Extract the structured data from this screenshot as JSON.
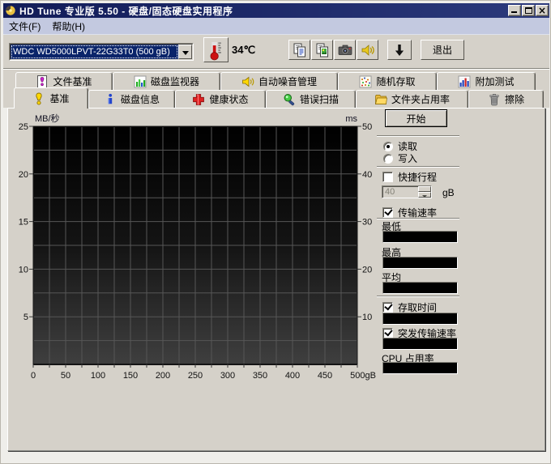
{
  "window": {
    "title": "HD Tune 专业版 5.50 - 硬盘/固态硬盘实用程序"
  },
  "menu": {
    "items": [
      "文件(F)",
      "帮助(H)"
    ]
  },
  "toolbar": {
    "drive_selected": "WDC WD5000LPVT-22G33T0 (500 gB)",
    "temperature": "34℃",
    "exit_label": "退出"
  },
  "tabs": {
    "row1": [
      {
        "label": "文件基准",
        "icon": "file-benchmark"
      },
      {
        "label": "磁盘监视器",
        "icon": "disk-monitor"
      },
      {
        "label": "自动噪音管理",
        "icon": "aam"
      },
      {
        "label": "随机存取",
        "icon": "random-access"
      },
      {
        "label": "附加测试",
        "icon": "extra-tests"
      }
    ],
    "row2": [
      {
        "label": "基准",
        "icon": "benchmark",
        "active": true
      },
      {
        "label": "磁盘信息",
        "icon": "disk-info"
      },
      {
        "label": "健康状态",
        "icon": "health"
      },
      {
        "label": "错误扫描",
        "icon": "error-scan"
      },
      {
        "label": "文件夹占用率",
        "icon": "folder-usage"
      },
      {
        "label": "擦除",
        "icon": "erase"
      }
    ]
  },
  "chart_data": {
    "type": "line",
    "series": [],
    "note": "empty benchmark grid, no measurement data plotted",
    "y_left": {
      "label": "MB/秒",
      "ticks": [
        "25",
        "20",
        "15",
        "10",
        "5"
      ],
      "range": [
        0,
        25
      ]
    },
    "y_right": {
      "label": "ms",
      "ticks": [
        "50",
        "40",
        "30",
        "20",
        "10"
      ],
      "range": [
        0,
        50
      ]
    },
    "x": {
      "ticks": [
        "0",
        "50",
        "100",
        "150",
        "200",
        "250",
        "300",
        "350",
        "400",
        "450",
        "500gB"
      ],
      "range": [
        0,
        500
      ]
    },
    "grid": true
  },
  "controls": {
    "start_label": "开始",
    "read_label": "读取",
    "write_label": "写入",
    "read_selected": true,
    "short_stroke_label": "快捷行程",
    "short_stroke_checked": false,
    "capacity_value": "40",
    "capacity_unit": "gB",
    "transfer_label": "传输速率",
    "transfer_checked": true,
    "min_label": "最低",
    "max_label": "最高",
    "avg_label": "平均",
    "access_label": "存取时间",
    "access_checked": true,
    "burst_label": "突发传输速率",
    "burst_checked": true,
    "cpu_label": "CPU 占用率"
  }
}
